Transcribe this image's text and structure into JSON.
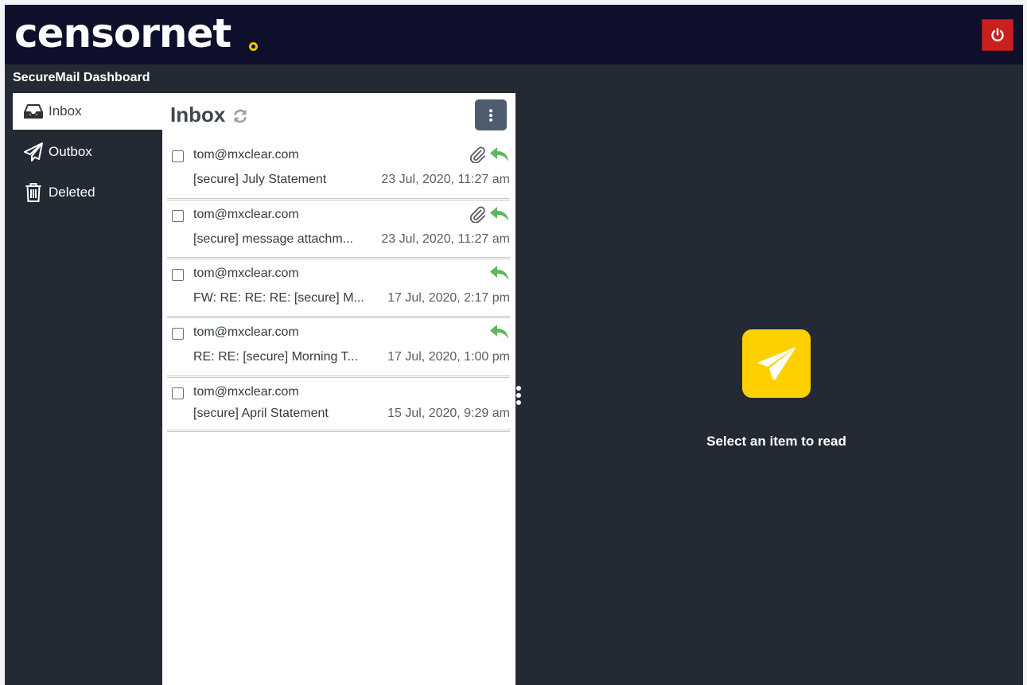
{
  "header": {
    "logo_text": "censornet",
    "logo_dot_color": "#f5c400",
    "power_icon": "power-icon",
    "dashboard_title": "SecureMail Dashboard"
  },
  "sidebar": {
    "items": [
      {
        "label": "Inbox",
        "icon": "inbox-icon",
        "active": true
      },
      {
        "label": "Outbox",
        "icon": "paper-plane-icon",
        "active": false
      },
      {
        "label": "Deleted",
        "icon": "trash-icon",
        "active": false
      }
    ]
  },
  "list": {
    "title": "Inbox",
    "messages": [
      {
        "from": "tom@mxclear.com",
        "subject": "[secure] July Statement",
        "date": "23 Jul, 2020, 11:27 am",
        "attachment": true,
        "replied": true
      },
      {
        "from": "tom@mxclear.com",
        "subject": "[secure] message attachm...",
        "date": "23 Jul, 2020, 11:27 am",
        "attachment": true,
        "replied": true
      },
      {
        "from": "tom@mxclear.com",
        "subject": "FW: RE: RE: RE: [secure] M...",
        "date": "17 Jul, 2020, 2:17 pm",
        "attachment": false,
        "replied": true
      },
      {
        "from": "tom@mxclear.com",
        "subject": "RE: RE: [secure] Morning T...",
        "date": "17 Jul, 2020, 1:00 pm",
        "attachment": false,
        "replied": true
      },
      {
        "from": "tom@mxclear.com",
        "subject": "[secure] April Statement",
        "date": "15 Jul, 2020, 9:29 am",
        "attachment": false,
        "replied": false
      }
    ]
  },
  "reader": {
    "placeholder": "Select an item to read",
    "icon": "paper-plane-icon"
  },
  "colors": {
    "topbar": "#0e0f2b",
    "background": "#242a33",
    "power_button": "#c8201f",
    "reply_arrow": "#5cb85c",
    "accent_yellow": "#ffd000"
  }
}
